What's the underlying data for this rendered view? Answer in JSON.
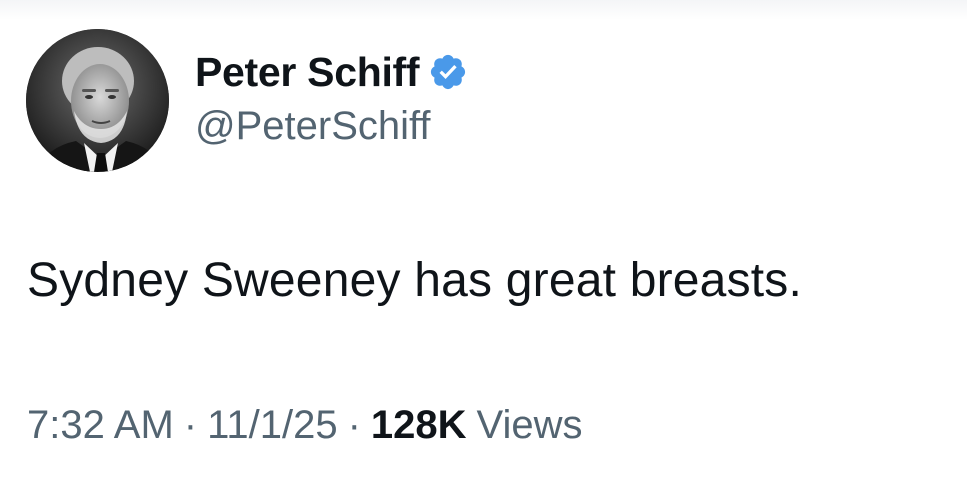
{
  "user": {
    "display_name": "Peter Schiff",
    "handle": "@PeterSchiff",
    "verified_icon": "verified-badge-icon",
    "verified_color": "#4a99e9",
    "avatar_icon": "profile-photo"
  },
  "tweet": {
    "text": "Sydney Sweeney has great breasts.",
    "time": "7:32 AM",
    "date": "11/1/25",
    "separator": "·",
    "views_count": "128K",
    "views_label": "Views"
  }
}
